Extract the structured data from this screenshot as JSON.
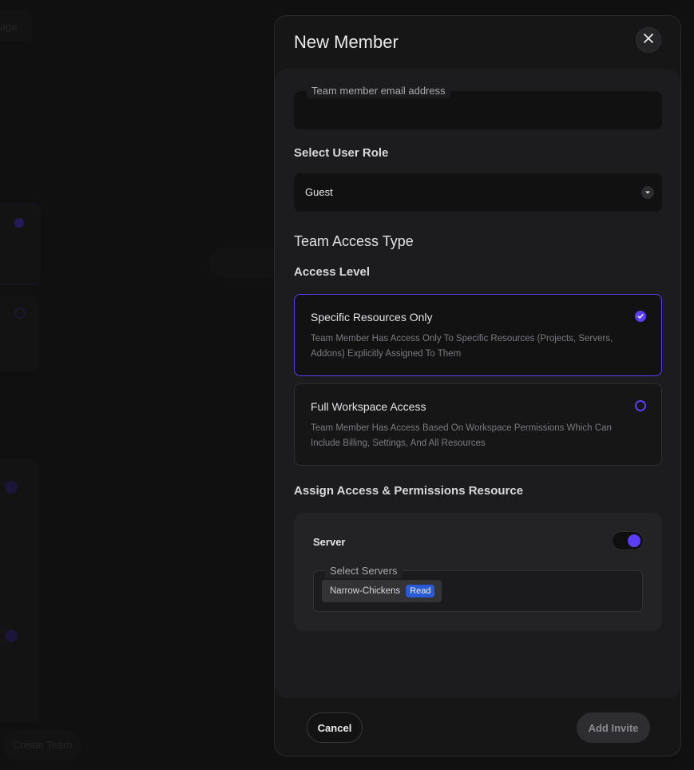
{
  "background": {
    "top_button_label": "age",
    "bottom_button_label": "Create Team"
  },
  "modal": {
    "title": "New Member",
    "close_icon": "close-icon",
    "email_field": {
      "label": "Team member email address",
      "value": ""
    },
    "role": {
      "label": "Select User Role",
      "value": "Guest"
    },
    "access_type_heading": "Team Access Type",
    "access_level_label": "Access Level",
    "options": [
      {
        "title": "Specific Resources Only",
        "description": "Team Member Has Access Only To Specific Resources (Projects, Servers, Addons) Explicitly Assigned To Them",
        "selected": true
      },
      {
        "title": "Full Workspace Access",
        "description": "Team Member Has Access Based On Workspace Permissions Which Can Include Billing, Settings, And All Resources",
        "selected": false
      }
    ],
    "assign_heading": "Assign Access & Permissions Resource",
    "resource": {
      "title": "Server",
      "enabled": true,
      "select_label": "Select Servers",
      "chips": [
        {
          "name": "Narrow-Chickens",
          "permission": "Read"
        }
      ]
    },
    "footer": {
      "cancel_label": "Cancel",
      "submit_label": "Add Invite"
    }
  },
  "colors": {
    "accent": "#5b3df5",
    "badge": "#2a5bd7"
  }
}
